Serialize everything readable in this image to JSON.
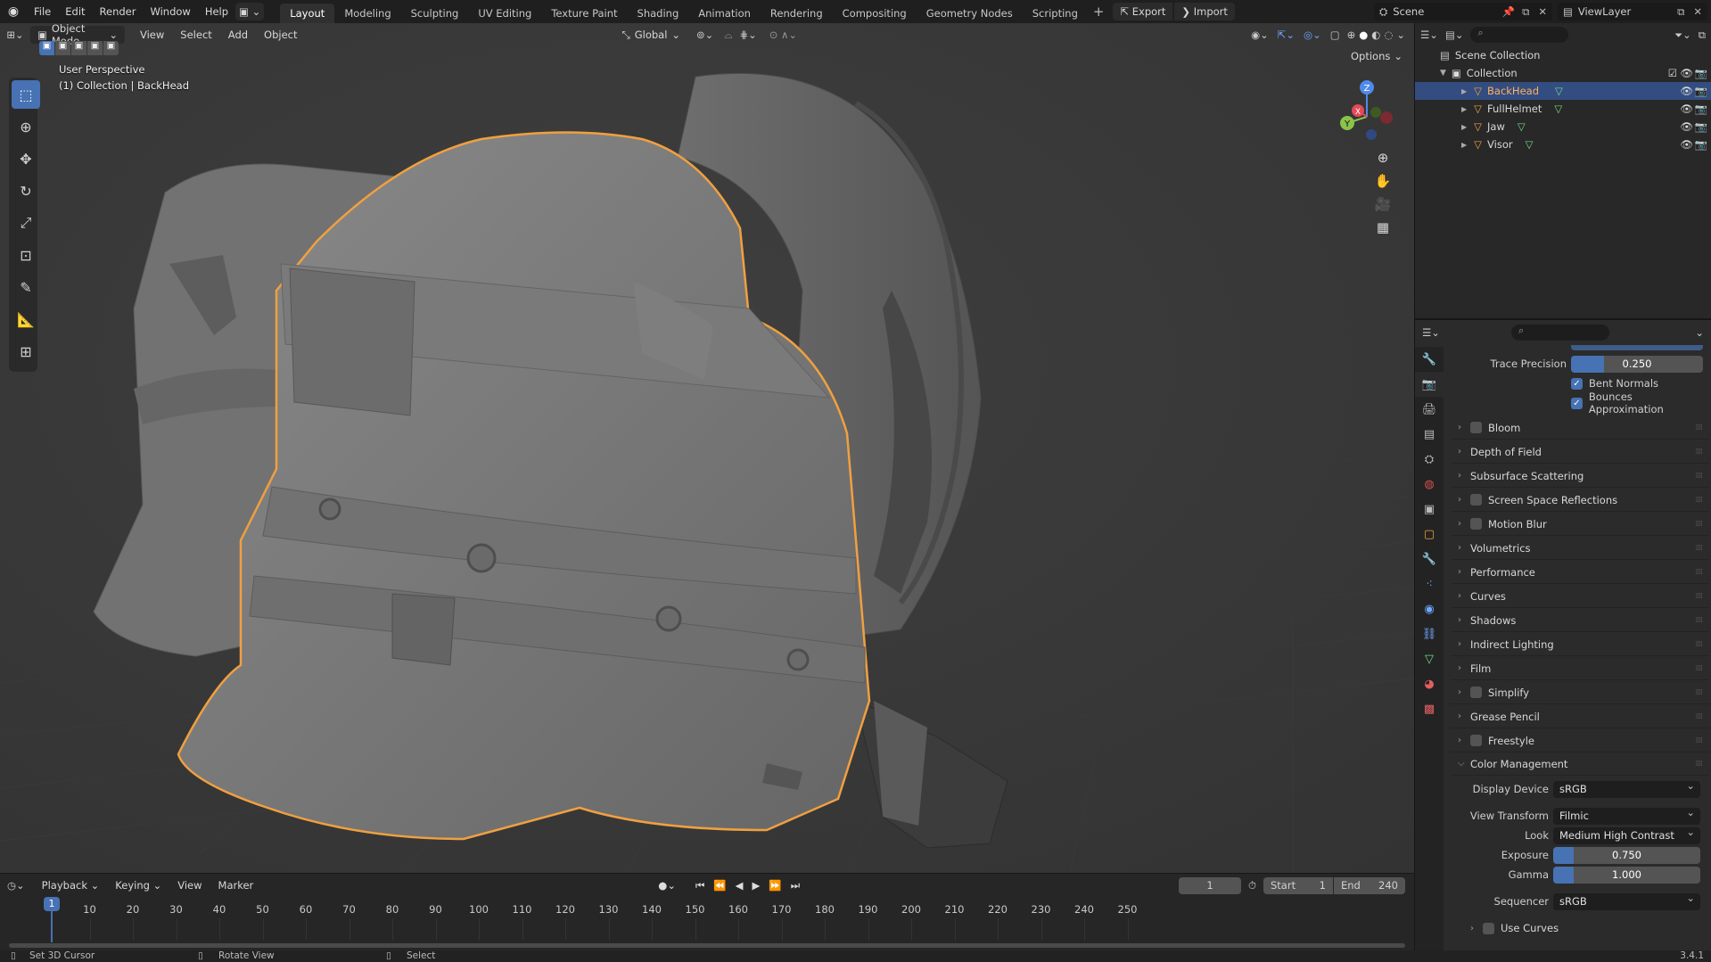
{
  "topbar": {
    "menus": [
      "File",
      "Edit",
      "Render",
      "Window",
      "Help"
    ],
    "workspaces": [
      "Layout",
      "Modeling",
      "Sculpting",
      "UV Editing",
      "Texture Paint",
      "Shading",
      "Animation",
      "Rendering",
      "Compositing",
      "Geometry Nodes",
      "Scripting"
    ],
    "active_workspace": "Layout",
    "export_label": "Export",
    "import_label": "Import",
    "scene_name": "Scene",
    "view_layer": "ViewLayer"
  },
  "viewport": {
    "mode": "Object Mode",
    "menus": [
      "View",
      "Select",
      "Add",
      "Object"
    ],
    "orientation": "Global",
    "options_label": "Options",
    "overlay_title": "User Perspective",
    "overlay_sub": "(1) Collection | BackHead",
    "axes": {
      "x": "X",
      "y": "Y",
      "z": "Z"
    }
  },
  "outliner": {
    "root": "Scene Collection",
    "collection": "Collection",
    "objects": [
      "BackHead",
      "FullHelmet",
      "Jaw",
      "Visor"
    ],
    "selected": "BackHead"
  },
  "properties": {
    "trace_precision_label": "Trace Precision",
    "trace_precision_value": "0.250",
    "trace_precision_fraction": 0.25,
    "bent_normals": "Bent Normals",
    "bounces_approx": "Bounces Approximation",
    "panels": [
      {
        "label": "Bloom",
        "checkbox": true
      },
      {
        "label": "Depth of Field",
        "checkbox": false
      },
      {
        "label": "Subsurface Scattering",
        "checkbox": false
      },
      {
        "label": "Screen Space Reflections",
        "checkbox": true
      },
      {
        "label": "Motion Blur",
        "checkbox": true
      },
      {
        "label": "Volumetrics",
        "checkbox": false
      },
      {
        "label": "Performance",
        "checkbox": false
      },
      {
        "label": "Curves",
        "checkbox": false
      },
      {
        "label": "Shadows",
        "checkbox": false
      },
      {
        "label": "Indirect Lighting",
        "checkbox": false
      },
      {
        "label": "Film",
        "checkbox": false
      },
      {
        "label": "Simplify",
        "checkbox": true
      },
      {
        "label": "Grease Pencil",
        "checkbox": false
      },
      {
        "label": "Freestyle",
        "checkbox": true
      }
    ],
    "color_management": {
      "title": "Color Management",
      "display_device_label": "Display Device",
      "display_device": "sRGB",
      "view_transform_label": "View Transform",
      "view_transform": "Filmic",
      "look_label": "Look",
      "look": "Medium High Contrast",
      "exposure_label": "Exposure",
      "exposure": "0.750",
      "exposure_fraction": 0.14,
      "gamma_label": "Gamma",
      "gamma": "1.000",
      "gamma_fraction": 0.14,
      "sequencer_label": "Sequencer",
      "sequencer": "sRGB",
      "use_curves": "Use Curves"
    }
  },
  "timeline": {
    "menus": [
      "Playback",
      "Keying",
      "View",
      "Marker"
    ],
    "current_frame": "1",
    "start_label": "Start",
    "start": "1",
    "end_label": "End",
    "end": "240",
    "ticks": [
      "1",
      "10",
      "20",
      "30",
      "40",
      "50",
      "60",
      "70",
      "80",
      "90",
      "100",
      "110",
      "120",
      "130",
      "140",
      "150",
      "160",
      "170",
      "180",
      "190",
      "200",
      "210",
      "220",
      "230",
      "240",
      "250"
    ]
  },
  "status": {
    "left": "Set 3D Cursor",
    "mid": "Rotate View",
    "right": "Select",
    "version": "3.4.1"
  },
  "colors": {
    "accent": "#4772b3",
    "selection_outline": "#f0a040",
    "viewport_bg": "#393939"
  }
}
